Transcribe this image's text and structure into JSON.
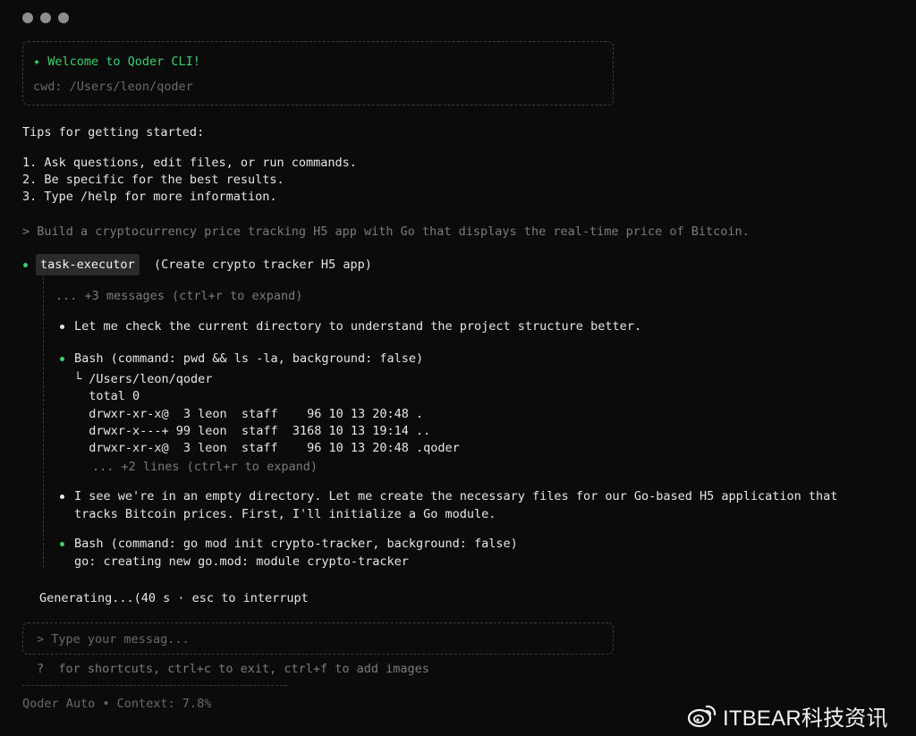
{
  "window": {
    "controls": [
      "close",
      "minimize",
      "maximize"
    ]
  },
  "welcome": {
    "icon": "sparkle-icon",
    "title": "✦ Welcome to Qoder CLI!",
    "cwd": "cwd: /Users/leon/qoder"
  },
  "tips": {
    "heading": "Tips for getting started:",
    "items": [
      "1. Ask questions, edit files, or run commands.",
      "2. Be specific for the best results.",
      "3. Type /help for more information."
    ]
  },
  "user_prompt": "> Build a cryptocurrency price tracking H5 app with Go that displays the real-time price of Bitcoin.",
  "agent": {
    "name": "task-executor",
    "description": "(Create crypto tracker H5 app)",
    "collapsed": "... +3 messages (ctrl+r to expand)",
    "steps": {
      "check": "Let me check the current directory to understand the project structure better.",
      "bash1": {
        "command": "Bash (command: pwd && ls -la, background: false)",
        "output": [
          "└ /Users/leon/qoder",
          "  total 0",
          "  drwxr-xr-x@  3 leon  staff    96 10 13 20:48 .",
          "  drwxr-x---+ 99 leon  staff  3168 10 13 19:14 ..",
          "  drwxr-xr-x@  3 leon  staff    96 10 13 20:48 .qoder"
        ],
        "more": "... +2 lines (ctrl+r to expand)"
      },
      "note": [
        "I see we're in an empty directory. Let me create the necessary files for our Go-based H5 application that",
        "tracks Bitcoin prices. First, I'll initialize a Go module."
      ],
      "bash2": {
        "command": "Bash (command: go mod init crypto-tracker, background: false)",
        "output": "go: creating new go.mod: module crypto-tracker"
      }
    }
  },
  "status": "Generating...(40 s · esc to interrupt",
  "input": {
    "placeholder": "> Type your messag..."
  },
  "help_line": "?  for shortcuts, ctrl+c to exit, ctrl+f to add images",
  "footer": "Qoder Auto • Context: 7.8%",
  "watermark": "ITBEAR科技资讯"
}
